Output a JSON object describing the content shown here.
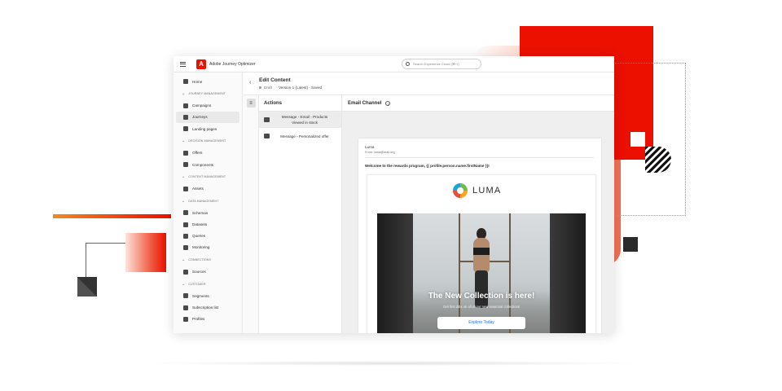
{
  "app": {
    "name": "Adobe Journey Optimizer",
    "logo_letter": "A",
    "search_placeholder": "Search Experience Cloud (⌘+/)"
  },
  "sidebar": {
    "items": [
      {
        "type": "item",
        "label": "Home",
        "icon": "home-icon"
      },
      {
        "type": "section",
        "label": "Journey Management"
      },
      {
        "type": "item",
        "label": "Campaigns",
        "icon": "megaphone-icon"
      },
      {
        "type": "item",
        "label": "Journeys",
        "icon": "journey-icon",
        "active": true
      },
      {
        "type": "item",
        "label": "Landing pages",
        "icon": "webpage-icon"
      },
      {
        "type": "section",
        "label": "Decision Management"
      },
      {
        "type": "item",
        "label": "Offers",
        "icon": "offers-icon"
      },
      {
        "type": "item",
        "label": "Components",
        "icon": "components-icon"
      },
      {
        "type": "section",
        "label": "Content Management"
      },
      {
        "type": "item",
        "label": "Assets",
        "icon": "assets-icon"
      },
      {
        "type": "section",
        "label": "Data Management"
      },
      {
        "type": "item",
        "label": "Schemas",
        "icon": "schema-icon"
      },
      {
        "type": "item",
        "label": "Datasets",
        "icon": "dataset-icon"
      },
      {
        "type": "item",
        "label": "Queries",
        "icon": "query-icon"
      },
      {
        "type": "item",
        "label": "Monitoring",
        "icon": "monitoring-icon"
      },
      {
        "type": "section",
        "label": "Connections"
      },
      {
        "type": "item",
        "label": "Sources",
        "icon": "sources-icon"
      },
      {
        "type": "section",
        "label": "Customer"
      },
      {
        "type": "item",
        "label": "Segments",
        "icon": "segments-icon"
      },
      {
        "type": "item",
        "label": "Subscription list",
        "icon": "list-icon"
      },
      {
        "type": "item",
        "label": "Profiles",
        "icon": "profile-icon"
      }
    ]
  },
  "header": {
    "title": "Edit Content",
    "status": "Draft",
    "version": "Version 1 (Latest) - Saved"
  },
  "actions": {
    "title": "Actions",
    "items": [
      {
        "label": "Message - Email - Products Viewed in stock",
        "icon": "email-icon",
        "selected": true
      },
      {
        "label": "Message - Personalized offer",
        "icon": "offer-message-icon",
        "selected": false
      }
    ]
  },
  "channel": {
    "title": "Email Channel",
    "sender": "Luma",
    "from": "From: luma@mail.org",
    "subject": "Welcome to the rewards program, {{ profile.person.name.firstName }}!",
    "brand": "LUMA",
    "hero_title": "The New Collection is here!",
    "hero_subtitle": "Get first dibs on all of our new seasonal collections",
    "cta": "Explore Today"
  },
  "colors": {
    "brand_red": "#eb1000",
    "link_blue": "#1473e6"
  }
}
